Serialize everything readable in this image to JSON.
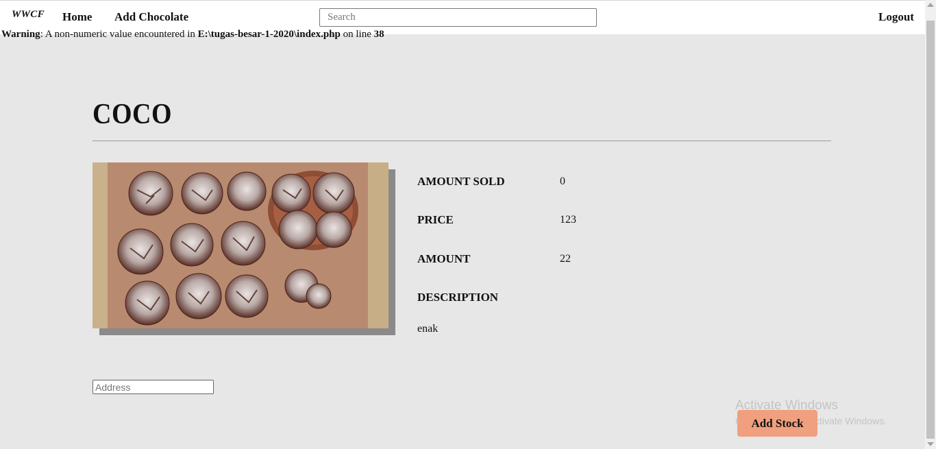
{
  "nav": {
    "brand": "WWCF",
    "home": "Home",
    "add_chocolate": "Add Chocolate",
    "search_placeholder": "Search",
    "logout": "Logout"
  },
  "warning": {
    "label": "Warning",
    "text1": ": A non-numeric value encountered in ",
    "path": "E:\\tugas-besar-1-2020\\index.php",
    "text2": " on line ",
    "line": "38"
  },
  "product": {
    "name": "COCO",
    "image_icon": "crinkle-cookies-photo",
    "details": {
      "amount_sold_label": "AMOUNT SOLD",
      "amount_sold": "0",
      "price_label": "PRICE",
      "price": "123",
      "amount_label": "AMOUNT",
      "amount": "22",
      "description_label": "DESCRIPTION",
      "description": "enak"
    }
  },
  "form": {
    "address_placeholder": "Address",
    "add_stock_label": "Add Stock"
  },
  "watermark": {
    "line1": "Activate Windows",
    "line2": "Go to Settings to activate Windows."
  },
  "colors": {
    "background": "#e7e7e7",
    "navbar": "#ffffff",
    "button": "#f0a07e",
    "image_shadow": "#8a8a8a"
  }
}
